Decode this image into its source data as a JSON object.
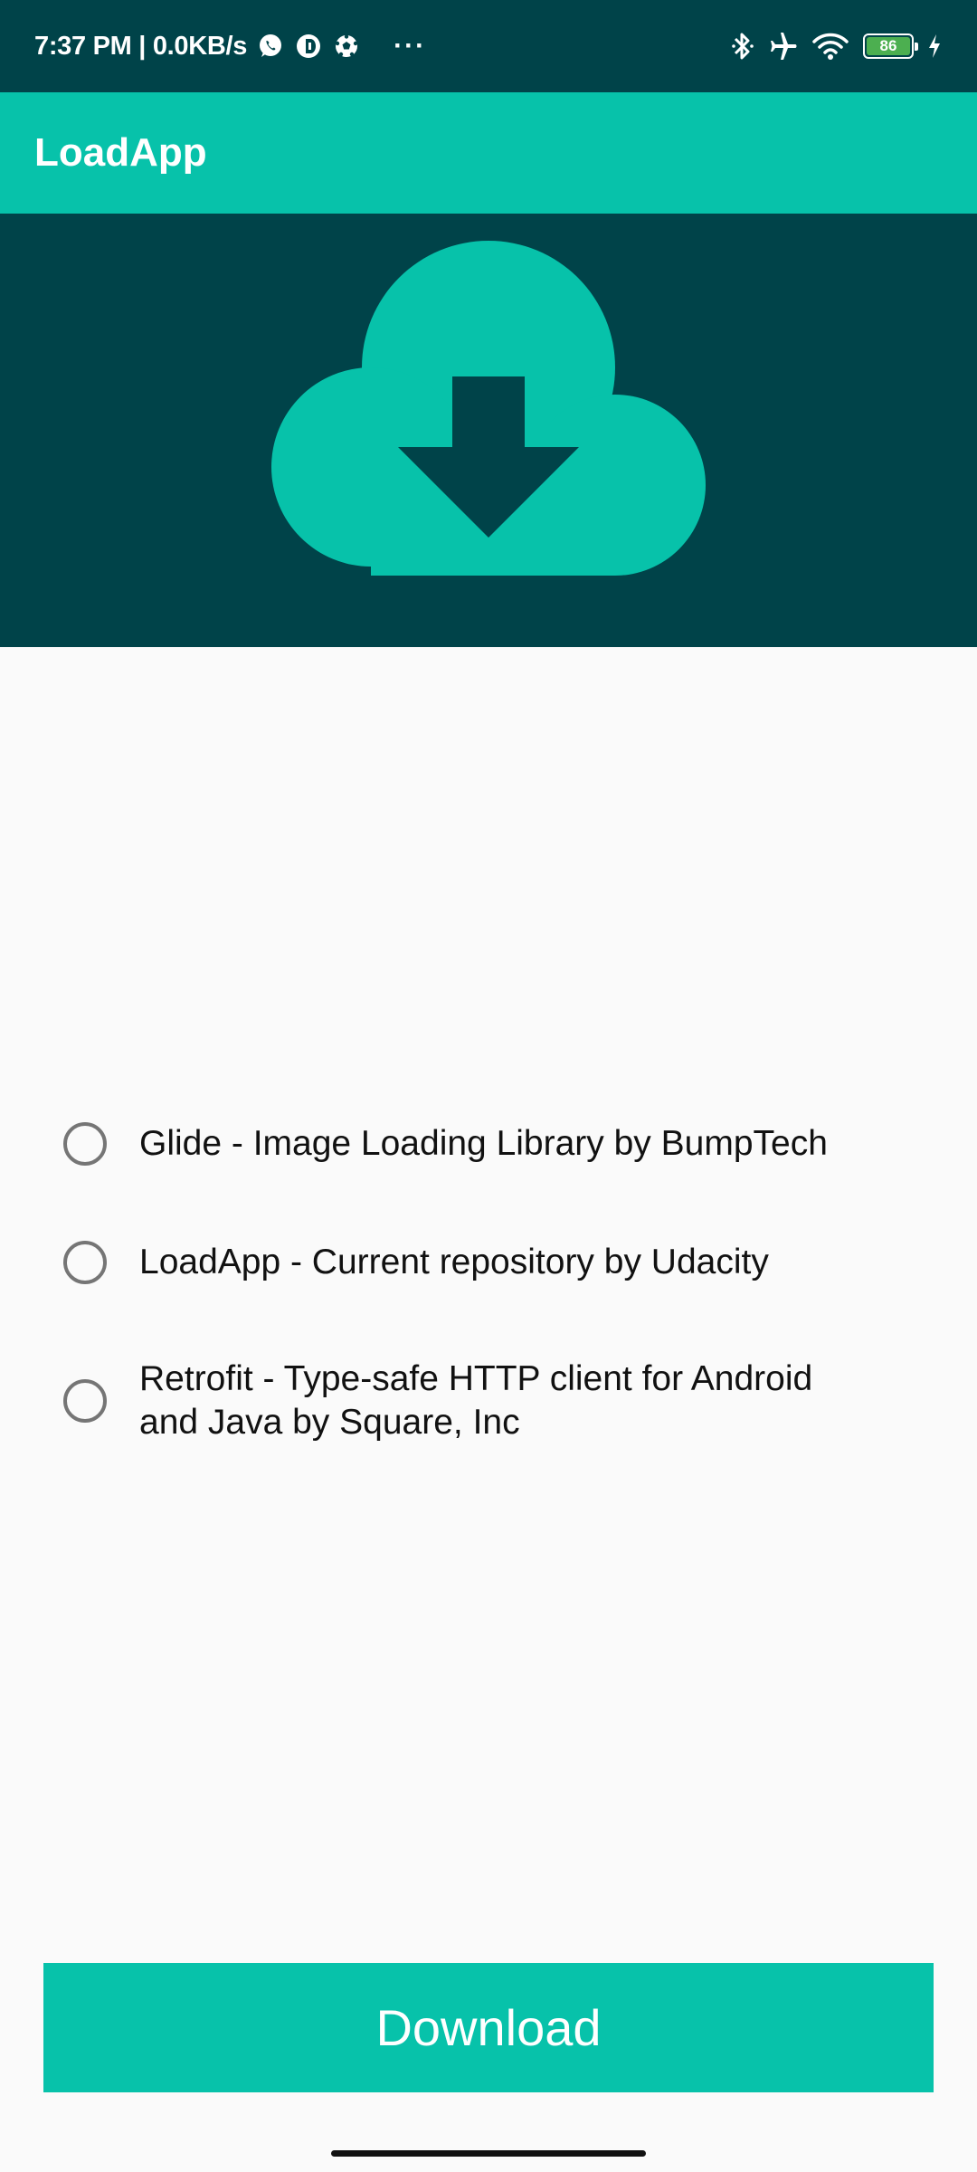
{
  "status_bar": {
    "time_speed": "7:37 PM | 0.0KB/s",
    "overflow": "···",
    "battery_level": "86",
    "icons": [
      "whatsapp-icon",
      "app-notification-icon",
      "soccer-ball-icon",
      "bluetooth-icon",
      "airplane-mode-icon",
      "wifi-icon",
      "battery-icon",
      "charging-icon"
    ]
  },
  "app_bar": {
    "title": "LoadApp"
  },
  "hero": {
    "icon": "cloud-download-icon"
  },
  "options": [
    {
      "label": "Glide - Image Loading Library by BumpTech",
      "selected": false
    },
    {
      "label": "LoadApp - Current repository by Udacity",
      "selected": false
    },
    {
      "label": "Retrofit - Type-safe HTTP client for Android and Java by Square, Inc",
      "selected": false
    }
  ],
  "download_button": {
    "label": "Download"
  },
  "colors": {
    "primary": "#07c2aa",
    "primary_dark": "#004349",
    "background": "#fafafa"
  }
}
